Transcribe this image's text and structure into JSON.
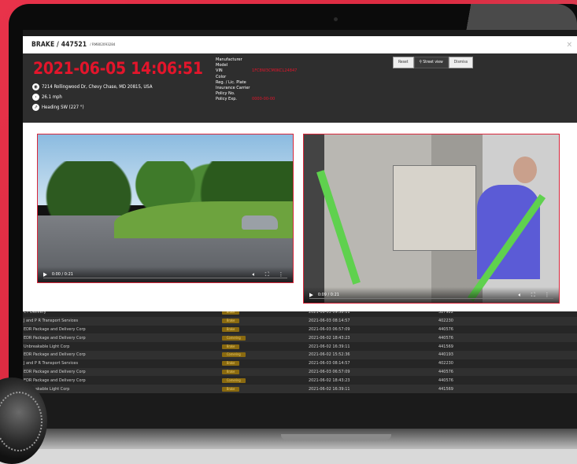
{
  "modal": {
    "title": "BRAKE / 447521",
    "subtitle": "/ RM802093284",
    "close_icon": "close-icon",
    "datetime": "2021-06-05 14:06:51",
    "address": "7214 Rollingwood Dr, Chevy Chase, MD 20815, USA",
    "speed": "26.1 mph",
    "heading": "Heading SW (227 °)",
    "meta": [
      {
        "label": "Manufacturer",
        "value": ""
      },
      {
        "label": "Model",
        "value": ""
      },
      {
        "label": "VIN",
        "value": "1FC8W3CM0KCL24847"
      },
      {
        "label": "Color",
        "value": ""
      },
      {
        "label": "Reg. / Lic. Plate",
        "value": ""
      },
      {
        "label": "Insurance Carrier",
        "value": ""
      },
      {
        "label": "Policy No.",
        "value": ""
      },
      {
        "label": "Policy Exp.",
        "value": "0000-00-00"
      }
    ],
    "buttons": {
      "reset": "Reset",
      "street_view": "Street view",
      "dismiss": "Dismiss"
    },
    "videos": [
      {
        "time": "0:00 / 0:21"
      },
      {
        "time": "0:09 / 0:21"
      }
    ]
  },
  "background_table": [
    {
      "company": "CT Delivery",
      "badge": "Brake",
      "date": "2021-06-03 09:58:11",
      "id": "327922"
    },
    {
      "company": "J and P R Transport Services",
      "badge": "Brake",
      "date": "2021-06-03 08:14:57",
      "id": "402230"
    },
    {
      "company": "EDR Package and Delivery Corp",
      "badge": "Brake",
      "date": "2021-06-03 06:57:09",
      "id": "440576"
    },
    {
      "company": "EDR Package and Delivery Corp",
      "badge": "Cornering",
      "date": "2021-06-02 18:43:23",
      "id": "440576"
    },
    {
      "company": "Unbreakable Light Corp",
      "badge": "Brake",
      "date": "2021-06-02 16:39:11",
      "id": "441569"
    },
    {
      "company": "EDR Package and Delivery Corp",
      "badge": "Cornering",
      "date": "2021-06-02 15:52:36",
      "id": "440193"
    },
    {
      "company": "J and P R Transport Services",
      "badge": "Brake",
      "date": "2021-06-03 08:14:57",
      "id": "402230"
    },
    {
      "company": "EDR Package and Delivery Corp",
      "badge": "Brake",
      "date": "2021-06-03 06:57:09",
      "id": "440576"
    },
    {
      "company": "EDR Package and Delivery Corp",
      "badge": "Cornering",
      "date": "2021-06-02 18:43:23",
      "id": "440576"
    },
    {
      "company": "Unbreakable Light Corp",
      "badge": "Brake",
      "date": "2021-06-02 16:39:11",
      "id": "441569"
    }
  ]
}
